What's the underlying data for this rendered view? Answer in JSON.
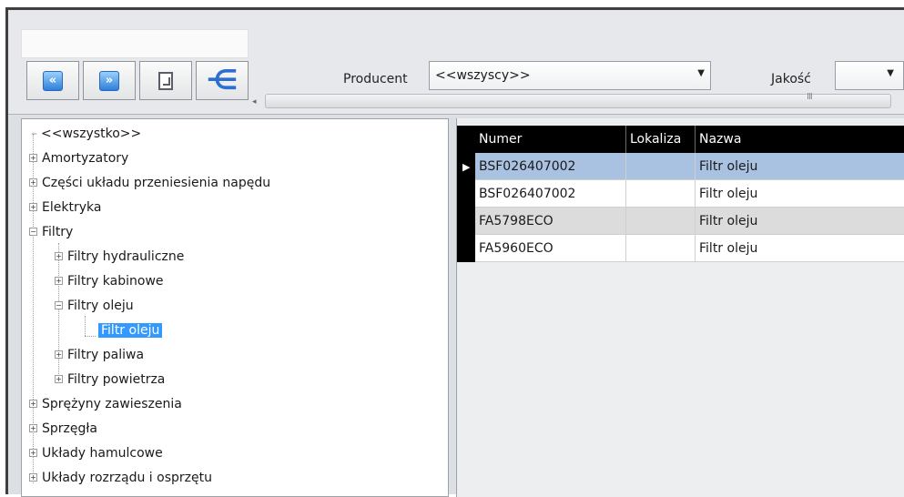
{
  "toolbar": {
    "nav_buttons": [
      {
        "icon": "first-page-icon",
        "glyph": "«"
      },
      {
        "icon": "last-page-icon",
        "glyph": "»"
      },
      {
        "icon": "report-document-icon"
      },
      {
        "icon": "tree-structure-icon",
        "glyph": "⋲"
      }
    ],
    "producer_label": "Producent",
    "producer_value": "<<wszyscy>>",
    "quality_label": "Jakość",
    "quality_value": "",
    "scroll_grip": "III",
    "scroll_left_arrow": "◂"
  },
  "tree": {
    "root": "<<wszystko>>",
    "items": [
      {
        "label": "Amortyzatory"
      },
      {
        "label": "Części układu przeniesienia napędu"
      },
      {
        "label": "Elektryka"
      },
      {
        "label": "Filtry"
      },
      {
        "label": "Filtry hydrauliczne"
      },
      {
        "label": "Filtry kabinowe"
      },
      {
        "label": "Filtry oleju"
      },
      {
        "label": "Filtr oleju",
        "selected": true
      },
      {
        "label": "Filtry paliwa"
      },
      {
        "label": "Filtry powietrza"
      },
      {
        "label": "Sprężyny zawieszenia"
      },
      {
        "label": "Sprzęgła"
      },
      {
        "label": "Układy hamulcowe"
      },
      {
        "label": "Układy rozrządu i osprzętu"
      }
    ],
    "expand_glyph": "+",
    "collapse_glyph": "−",
    "leaf_dash": "–"
  },
  "grid": {
    "columns": [
      "Numer",
      "Lokaliza",
      "Nazwa"
    ],
    "row_pointer": "▶",
    "rows": [
      {
        "numer": "BSF026407002",
        "lokalizacja": "",
        "nazwa": "Filtr oleju",
        "state": "selected"
      },
      {
        "numer": "BSF026407002",
        "lokalizacja": "",
        "nazwa": "Filtr oleju",
        "state": "normal"
      },
      {
        "numer": "FA5798ECO",
        "lokalizacja": "",
        "nazwa": "Filtr oleju",
        "state": "alt"
      },
      {
        "numer": "FA5960ECO",
        "lokalizacja": "",
        "nazwa": "Filtr oleju",
        "state": "normal"
      }
    ],
    "row_colors": {
      "selected": "#a9c2e1",
      "normal": "#ffffff",
      "alt": "#dcdcdc"
    }
  }
}
